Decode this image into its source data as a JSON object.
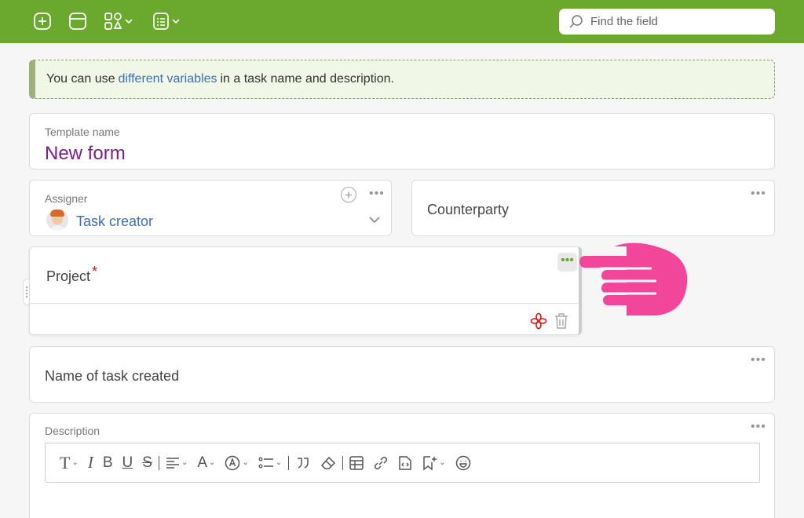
{
  "toolbar": {
    "buttons": [
      "add-icon",
      "layout-icon",
      "widgets-icon",
      "form-icon"
    ],
    "search_placeholder": "Find the field"
  },
  "hint": {
    "before": "You can use",
    "link": "different variables",
    "after": "in a task name and description."
  },
  "template": {
    "label": "Template name",
    "value": "New form"
  },
  "assigner": {
    "label": "Assigner",
    "value": "Task creator"
  },
  "counterparty": {
    "label": "Counterparty"
  },
  "project": {
    "label": "Project",
    "required_mark": "*"
  },
  "task_name": {
    "label": "Name of task created"
  },
  "description": {
    "label": "Description",
    "tools": [
      "T",
      "I",
      "B",
      "U",
      "S",
      "align",
      "A",
      "A-circle",
      "list",
      "quote",
      "eraser",
      "table",
      "link",
      "code",
      "bookmark-plus",
      "emoji"
    ]
  },
  "colors": {
    "accent": "#6aa82e",
    "template_value": "#7b1d8e",
    "link": "#3b6fb6",
    "required": "#e01010",
    "pointer": "#f2469a"
  }
}
